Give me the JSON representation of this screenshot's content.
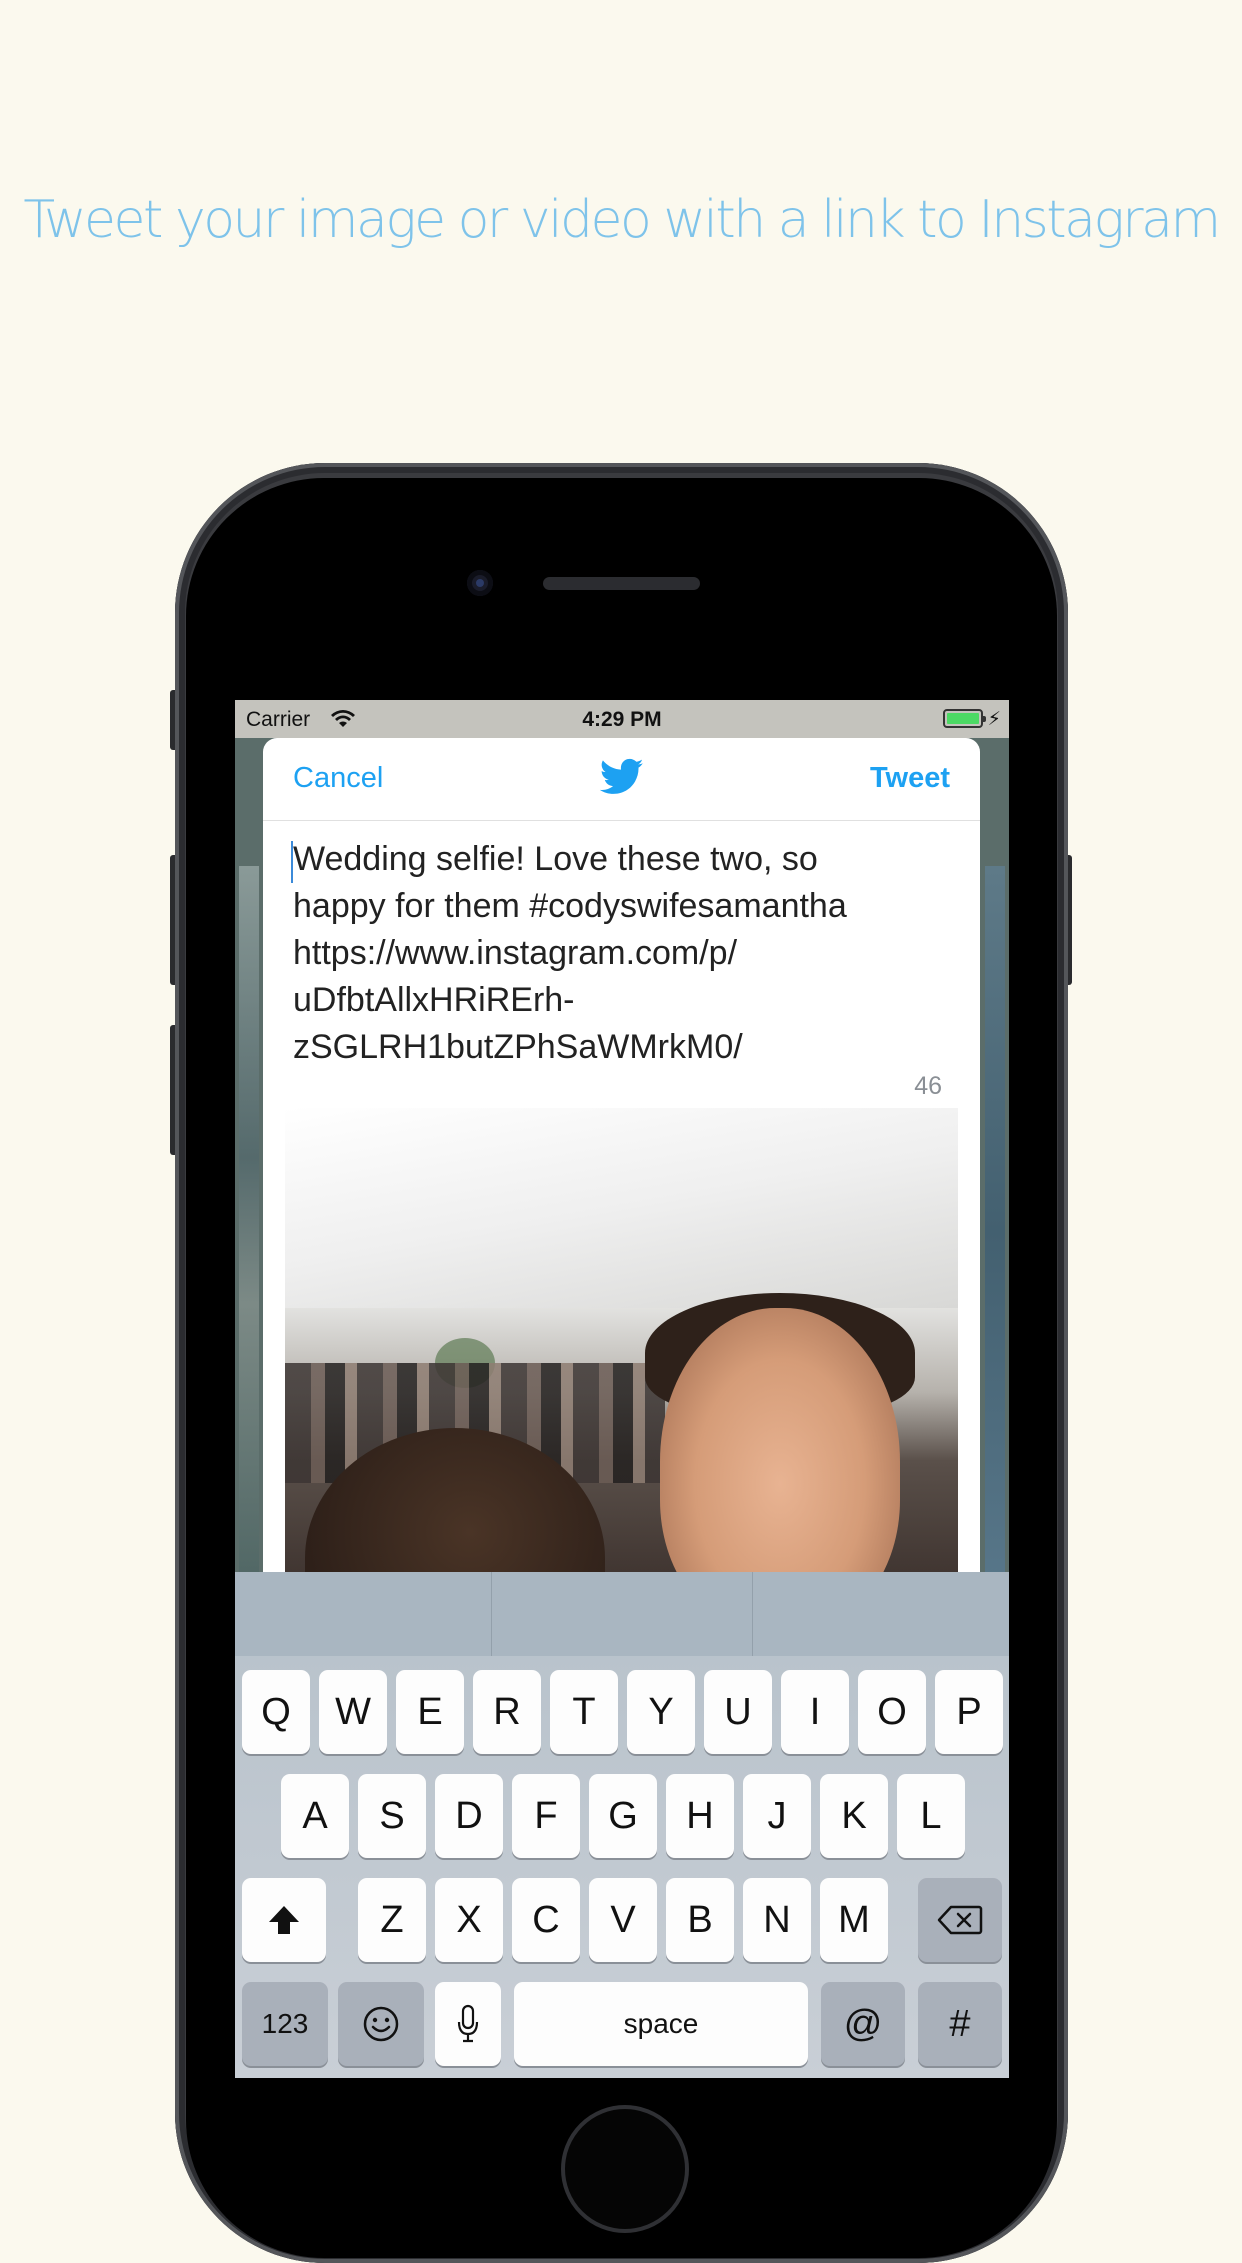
{
  "headline": "Tweet your image or video with a link to Instagram",
  "status_bar": {
    "carrier": "Carrier",
    "time": "4:29 PM"
  },
  "compose": {
    "cancel_label": "Cancel",
    "tweet_label": "Tweet",
    "logo_icon": "twitter-bird-icon",
    "text_lines": [
      "Wedding selfie! Love these two, so",
      "happy for them #codyswifesamantha",
      "https://www.instagram.com/p/",
      "uDfbtAllxHRiRErh-",
      "zSGLRH1butZPhSaWMrkM0/"
    ],
    "char_count": "46"
  },
  "keyboard": {
    "row1": [
      "Q",
      "W",
      "E",
      "R",
      "T",
      "Y",
      "U",
      "I",
      "O",
      "P"
    ],
    "row2": [
      "A",
      "S",
      "D",
      "F",
      "G",
      "H",
      "J",
      "K",
      "L"
    ],
    "row3": [
      "Z",
      "X",
      "C",
      "V",
      "B",
      "N",
      "M"
    ],
    "numbers_label": "123",
    "space_label": "space",
    "at_label": "@",
    "hash_label": "#",
    "shift_icon": "shift-arrow-icon",
    "delete_icon": "backspace-icon",
    "emoji_icon": "emoji-icon",
    "mic_icon": "microphone-icon"
  },
  "colors": {
    "accent": "#1da1f2",
    "headline": "#7ec3ea",
    "background": "#fbf9ee"
  }
}
